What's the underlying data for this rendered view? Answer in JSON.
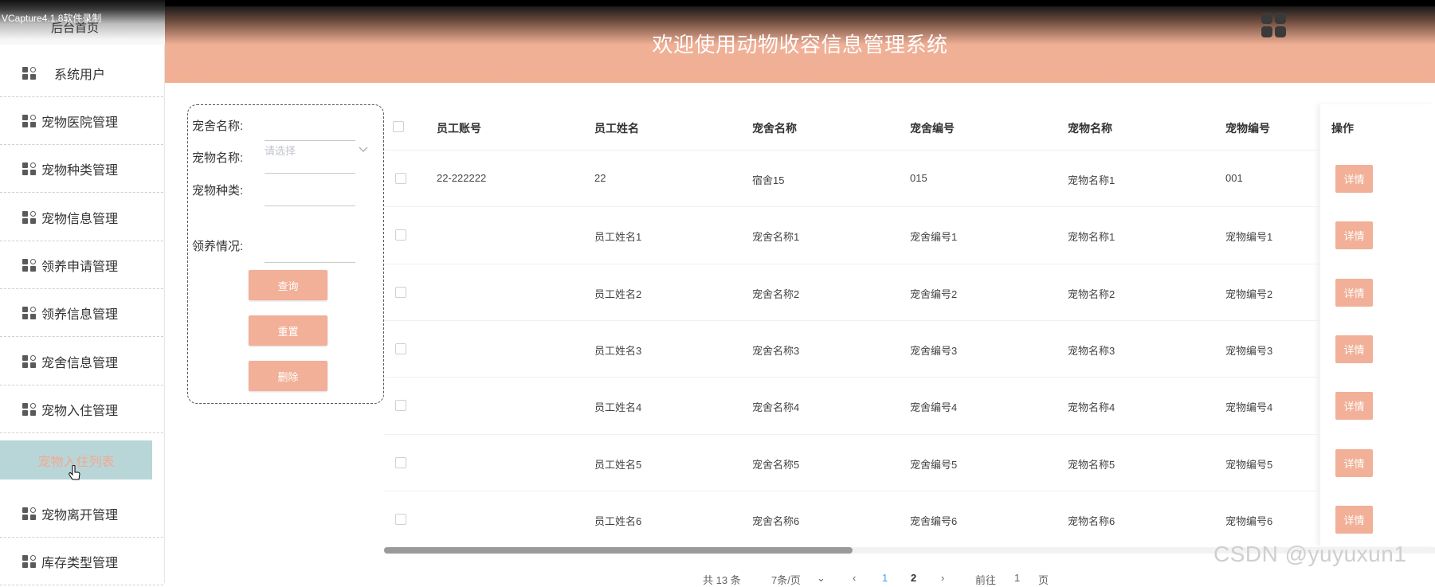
{
  "recorder_watermark": "VCapture4.1.8软件录制",
  "header": {
    "title": "欢迎使用动物收容信息管理系统"
  },
  "sidebar": {
    "home_label": "后台首页",
    "items": [
      {
        "label": "系统用户"
      },
      {
        "label": "宠物医院管理"
      },
      {
        "label": "宠物种类管理"
      },
      {
        "label": "宠物信息管理"
      },
      {
        "label": "领养申请管理"
      },
      {
        "label": "领养信息管理"
      },
      {
        "label": "宠舍信息管理"
      },
      {
        "label": "宠物入住管理"
      },
      {
        "label": "宠物入住列表"
      },
      {
        "label": "宠物离开管理"
      },
      {
        "label": "库存类型管理"
      }
    ]
  },
  "search": {
    "dorm_name_label": "宠舍名称:",
    "pet_name_label": "宠物名称:",
    "pet_name_placeholder": "请选择",
    "pet_type_label": "宠物种类:",
    "adoption_status_label": "领养情况:",
    "query_button": "查询",
    "reset_button": "重置",
    "delete_button": "删除"
  },
  "table": {
    "headers": [
      "员工账号",
      "员工姓名",
      "宠舍名称",
      "宠舍编号",
      "宠物名称",
      "宠物编号",
      "操作"
    ],
    "detail_label": "详情",
    "rows": [
      {
        "account": "22-222222",
        "name": "22",
        "dorm": "宿舍15",
        "dorm_no": "015",
        "pet": "宠物名称1",
        "pet_no": "001"
      },
      {
        "account": "",
        "name": "员工姓名1",
        "dorm": "宠舍名称1",
        "dorm_no": "宠舍编号1",
        "pet": "宠物名称1",
        "pet_no": "宠物编号1"
      },
      {
        "account": "",
        "name": "员工姓名2",
        "dorm": "宠舍名称2",
        "dorm_no": "宠舍编号2",
        "pet": "宠物名称2",
        "pet_no": "宠物编号2"
      },
      {
        "account": "",
        "name": "员工姓名3",
        "dorm": "宠舍名称3",
        "dorm_no": "宠舍编号3",
        "pet": "宠物名称3",
        "pet_no": "宠物编号3"
      },
      {
        "account": "",
        "name": "员工姓名4",
        "dorm": "宠舍名称4",
        "dorm_no": "宠舍编号4",
        "pet": "宠物名称4",
        "pet_no": "宠物编号4"
      },
      {
        "account": "",
        "name": "员工姓名5",
        "dorm": "宠舍名称5",
        "dorm_no": "宠舍编号5",
        "pet": "宠物名称5",
        "pet_no": "宠物编号5"
      },
      {
        "account": "",
        "name": "员工姓名6",
        "dorm": "宠舍名称6",
        "dorm_no": "宠舍编号6",
        "pet": "宠物名称6",
        "pet_no": "宠物编号6"
      }
    ]
  },
  "pagination": {
    "total": "共 13 条",
    "page_size": "7条/页",
    "pages": [
      "1",
      "2"
    ],
    "current_page": "1",
    "goto_label": "前往",
    "goto_value": "1",
    "page_suffix": "页"
  },
  "csdn_watermark": "CSDN @yuyuxun1",
  "colors": {
    "accent": "#f1b097",
    "active_bg": "#b8d6d8",
    "active_text": "#f3a890",
    "pager_active": "#409eff"
  }
}
